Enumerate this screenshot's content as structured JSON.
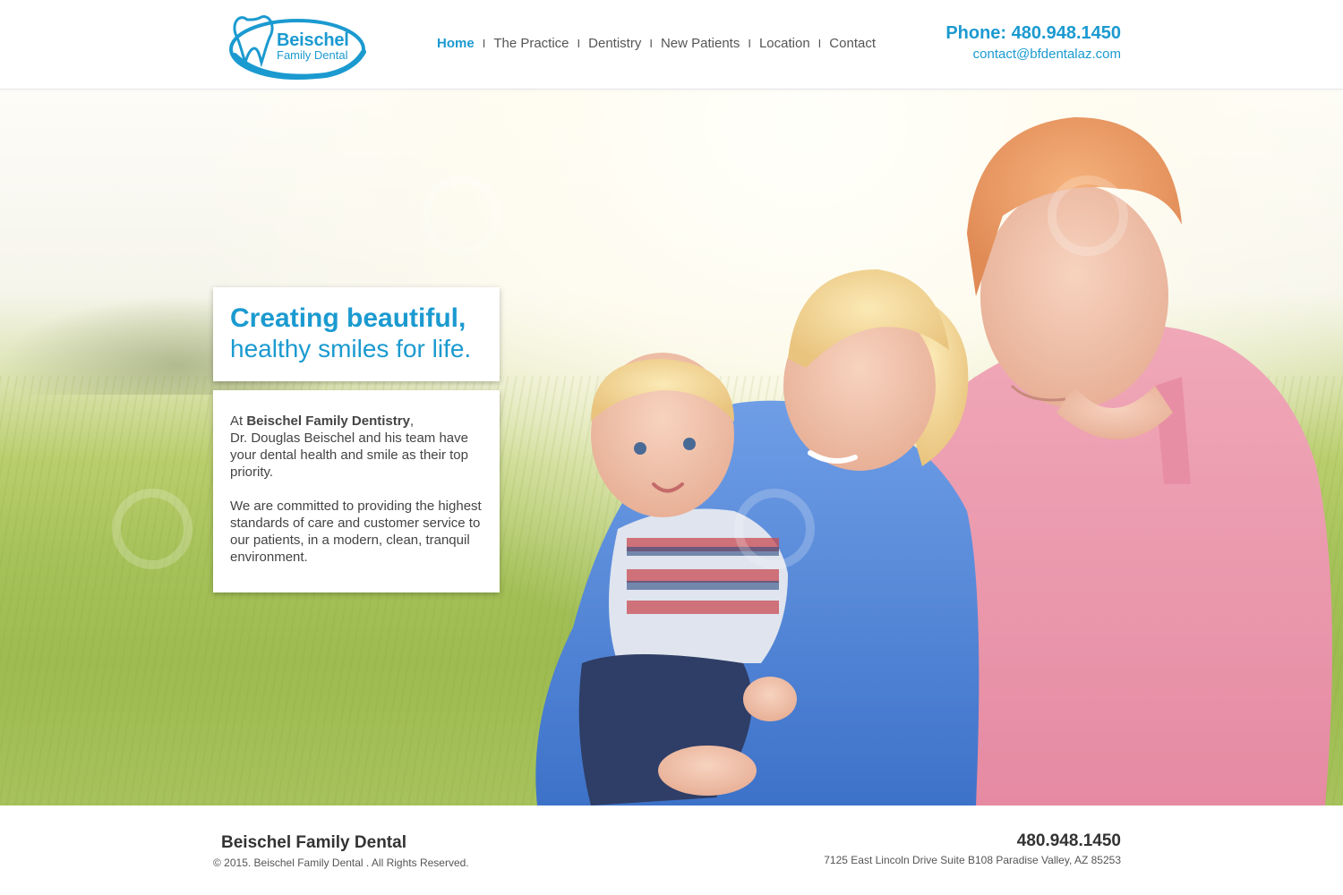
{
  "brand": {
    "name_line1": "Beischel",
    "name_line2": "Family Dental",
    "primary_color": "#1b9ad0"
  },
  "nav": {
    "items": [
      {
        "label": "Home",
        "active": true
      },
      {
        "label": "The Practice"
      },
      {
        "label": "Dentistry"
      },
      {
        "label": "New Patients"
      },
      {
        "label": "Location"
      },
      {
        "label": "Contact"
      }
    ],
    "separator": "I"
  },
  "contact": {
    "phone": "Phone: 480.948.1450",
    "email": "contact@bfdentalaz.com"
  },
  "hero": {
    "headline_bold": "Creating beautiful,",
    "headline_rest": "healthy smiles for life.",
    "intro_prefix": "At ",
    "intro_bold": "Beischel Family Dentistry",
    "intro_suffix": ",",
    "intro_rest": "Dr. Douglas Beischel and his team have your dental health and smile as their top priority.",
    "paragraph2": "We are committed to providing the highest standards of care and customer service to our patients, in a modern, clean, tranquil environment.",
    "image_description_icon": "family-photo"
  },
  "footer": {
    "name": "Beischel Family Dental",
    "copyright": "© 2015. Beischel Family Dental . All Rights Reserved.",
    "phone": "480.948.1450",
    "address": "7125 East Lincoln Drive Suite B108 Paradise Valley, AZ 85253"
  }
}
